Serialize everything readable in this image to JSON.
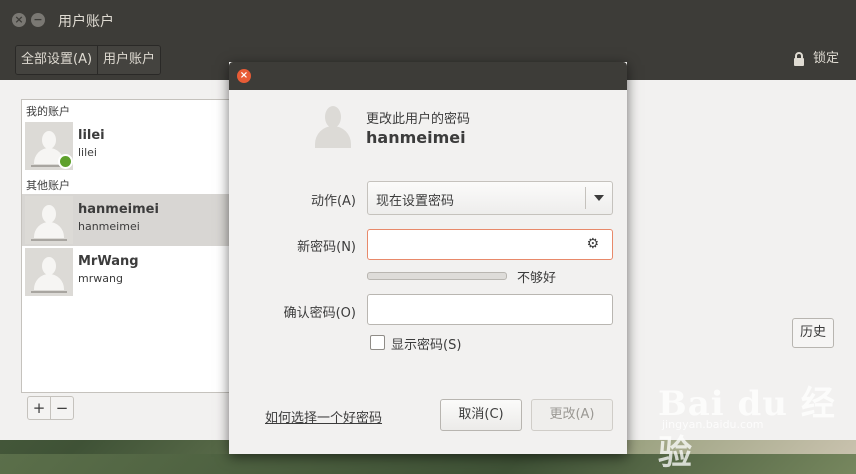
{
  "window": {
    "title": "用户账户"
  },
  "toolbar": {
    "crumbs": [
      "全部设置(A)",
      "用户账户"
    ],
    "lock_label": "锁定"
  },
  "users": {
    "my_section": "我的账户",
    "other_section": "其他账户",
    "items": [
      {
        "name": "lilei",
        "login": "lilei"
      },
      {
        "name": "hanmeimei",
        "login": "hanmeimei"
      },
      {
        "name": "MrWang",
        "login": "mrwang"
      }
    ],
    "add": "+",
    "remove": "−"
  },
  "history_label": "历史",
  "dialog": {
    "heading": "更改此用户的密码",
    "user": "hanmeimei",
    "action_label": "动作(A)",
    "action_value": "现在设置密码",
    "new_password_label": "新密码(N)",
    "strength_text": "不够好",
    "confirm_label": "确认密码(O)",
    "show_password_label": "显示密码(S)",
    "help_link": "如何选择一个好密码",
    "cancel_label": "取消(C)",
    "ok_label": "更改(A)"
  },
  "watermark": {
    "text": "Bai du 经验",
    "sub": "jingyan.baidu.com"
  }
}
